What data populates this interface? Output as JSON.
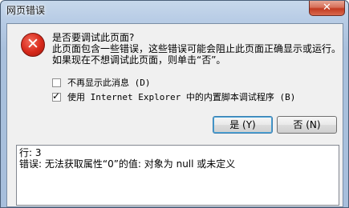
{
  "window": {
    "title": "网页错误",
    "close_label": "✕"
  },
  "icon": {
    "name": "error-icon",
    "glyph": "✕"
  },
  "message": {
    "question": "是否要调试此页面?",
    "detail": "此页面包含一些错误，这些错误可能会阻止此页面正确显示或运行。如果现在不想调试此页面，则单击“否”。"
  },
  "options": [
    {
      "label": "不再显示此消息 (D)",
      "checked": false
    },
    {
      "label": "使用 Internet Explorer 中的内置脚本调试程序 (B)",
      "checked": true
    }
  ],
  "buttons": {
    "yes": "是 (Y)",
    "no": "否 (N)"
  },
  "details": {
    "line": "行: 3",
    "error": "错误: 无法获取属性“0”的值: 对象为 null 或未定义"
  }
}
